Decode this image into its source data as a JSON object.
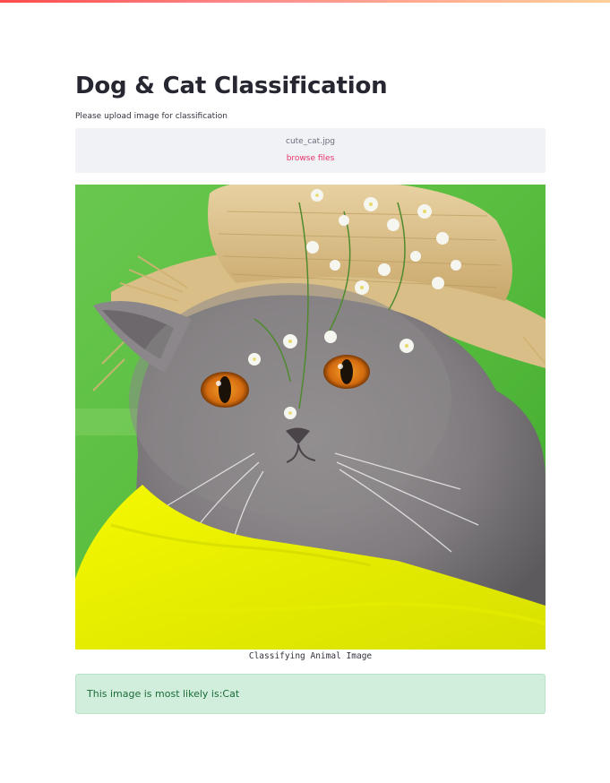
{
  "colors": {
    "accent_link": "#e8336a",
    "dropzone_bg": "#f0f2f6",
    "success_bg": "#d0eedb",
    "success_text": "#1b6b37"
  },
  "page": {
    "title": "Dog & Cat Classification"
  },
  "uploader": {
    "label": "Please upload image for classification",
    "file_name": "cute_cat.jpg",
    "browse_label": "browse files"
  },
  "image": {
    "subject": "gray cat wearing a straw hat with white flowers on a yellow cloth",
    "caption": "Classifying Animal Image"
  },
  "result": {
    "message": "This image is most likely is:Cat"
  }
}
